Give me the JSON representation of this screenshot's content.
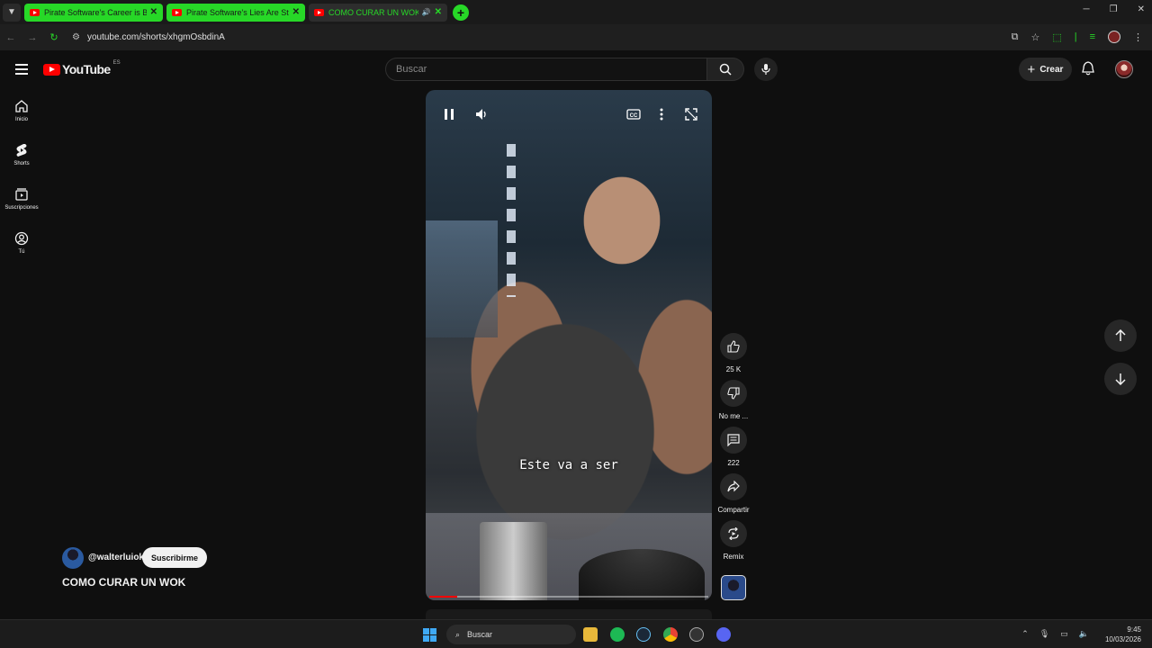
{
  "browser": {
    "tabs": [
      {
        "title": "Pirate Software's Career is Basi",
        "style": "green"
      },
      {
        "title": "Pirate Software's Lies Are Still C",
        "style": "green"
      },
      {
        "title": "COMO CURAR UN WOK - Y",
        "style": "active"
      }
    ],
    "url": "youtube.com/shorts/xhgmOsbdinA"
  },
  "youtube": {
    "logo_text": "YouTube",
    "country_code": "ES",
    "search_placeholder": "Buscar",
    "create_label": "Crear",
    "sidebar": [
      {
        "label": "Inicio",
        "icon": "home-icon"
      },
      {
        "label": "Shorts",
        "icon": "shorts-icon"
      },
      {
        "label": "Suscripciones",
        "icon": "subscriptions-icon"
      },
      {
        "label": "Tú",
        "icon": "you-icon"
      }
    ],
    "video": {
      "caption": "Este va a ser",
      "progress": 0.1
    },
    "actions": {
      "like_count": "25 K",
      "dislike_label": "No me ...",
      "comments_count": "222",
      "share_label": "Compartir",
      "remix_label": "Remix"
    },
    "channel": {
      "handle": "@walterluiok",
      "subscribe_label": "Suscribirme"
    },
    "video_title": "COMO CURAR UN WOK"
  },
  "taskbar": {
    "search_label": "Buscar",
    "time": "9:45",
    "date": "10/03/2026"
  },
  "colors": {
    "accent_green": "#27d827",
    "youtube_red": "#ff0000",
    "background": "#0f0f0f"
  }
}
